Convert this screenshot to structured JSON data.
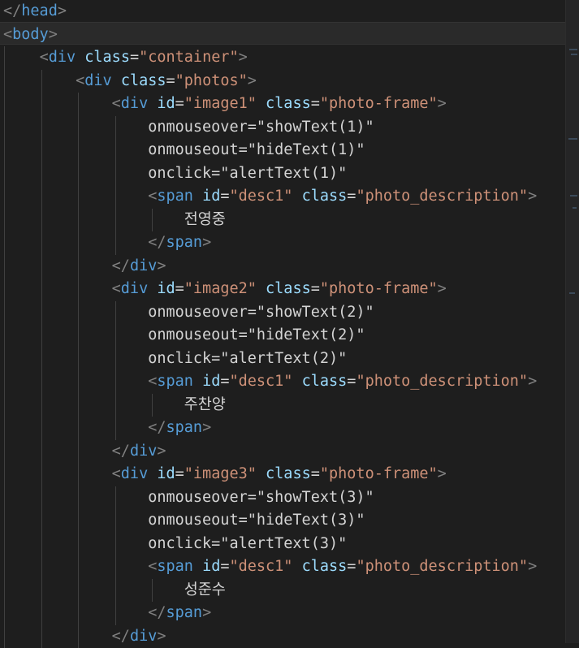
{
  "editor": {
    "lines": [
      {
        "parts": [
          [
            "t",
            "</"
          ],
          [
            "tag",
            "head"
          ],
          [
            "t",
            ">"
          ]
        ]
      },
      {
        "parts": [
          [
            "t",
            "<"
          ],
          [
            "tag",
            "body"
          ],
          [
            "t",
            ">"
          ]
        ]
      },
      {
        "parts": [
          [
            "txt",
            "    "
          ],
          [
            "t",
            "<"
          ],
          [
            "tag",
            "div"
          ],
          [
            "txt",
            " "
          ],
          [
            "attr",
            "class"
          ],
          [
            "txt",
            "="
          ],
          [
            "str",
            "\"container\""
          ],
          [
            "t",
            ">"
          ]
        ]
      },
      {
        "parts": [
          [
            "txt",
            "        "
          ],
          [
            "t",
            "<"
          ],
          [
            "tag",
            "div"
          ],
          [
            "txt",
            " "
          ],
          [
            "attr",
            "class"
          ],
          [
            "txt",
            "="
          ],
          [
            "str",
            "\"photos\""
          ],
          [
            "t",
            ">"
          ]
        ]
      },
      {
        "parts": [
          [
            "txt",
            "            "
          ],
          [
            "t",
            "<"
          ],
          [
            "tag",
            "div"
          ],
          [
            "txt",
            " "
          ],
          [
            "attr",
            "id"
          ],
          [
            "txt",
            "="
          ],
          [
            "str",
            "\"image1\""
          ],
          [
            "txt",
            " "
          ],
          [
            "attr",
            "class"
          ],
          [
            "txt",
            "="
          ],
          [
            "str",
            "\"photo-frame\""
          ],
          [
            "t",
            ">"
          ]
        ]
      },
      {
        "parts": [
          [
            "txt",
            "                onmouseover=\"showText(1)\""
          ]
        ]
      },
      {
        "parts": [
          [
            "txt",
            "                onmouseout=\"hideText(1)\""
          ]
        ]
      },
      {
        "parts": [
          [
            "txt",
            "                onclick=\"alertText(1)\""
          ]
        ]
      },
      {
        "parts": [
          [
            "txt",
            "                "
          ],
          [
            "t",
            "<"
          ],
          [
            "tag",
            "span"
          ],
          [
            "txt",
            " "
          ],
          [
            "attr",
            "id"
          ],
          [
            "txt",
            "="
          ],
          [
            "str",
            "\"desc1\""
          ],
          [
            "txt",
            " "
          ],
          [
            "attr",
            "class"
          ],
          [
            "txt",
            "="
          ],
          [
            "str",
            "\"photo_description\""
          ],
          [
            "t",
            ">"
          ]
        ]
      },
      {
        "parts": [
          [
            "txt",
            "                    전영중"
          ]
        ]
      },
      {
        "parts": [
          [
            "txt",
            "                "
          ],
          [
            "t",
            "</"
          ],
          [
            "tag",
            "span"
          ],
          [
            "t",
            ">"
          ]
        ]
      },
      {
        "parts": [
          [
            "txt",
            "            "
          ],
          [
            "t",
            "</"
          ],
          [
            "tag",
            "div"
          ],
          [
            "t",
            ">"
          ]
        ]
      },
      {
        "parts": [
          [
            "txt",
            "            "
          ],
          [
            "t",
            "<"
          ],
          [
            "tag",
            "div"
          ],
          [
            "txt",
            " "
          ],
          [
            "attr",
            "id"
          ],
          [
            "txt",
            "="
          ],
          [
            "str",
            "\"image2\""
          ],
          [
            "txt",
            " "
          ],
          [
            "attr",
            "class"
          ],
          [
            "txt",
            "="
          ],
          [
            "str",
            "\"photo-frame\""
          ],
          [
            "t",
            ">"
          ]
        ]
      },
      {
        "parts": [
          [
            "txt",
            "                onmouseover=\"showText(2)\""
          ]
        ]
      },
      {
        "parts": [
          [
            "txt",
            "                onmouseout=\"hideText(2)\""
          ]
        ]
      },
      {
        "parts": [
          [
            "txt",
            "                onclick=\"alertText(2)\""
          ]
        ]
      },
      {
        "parts": [
          [
            "txt",
            "                "
          ],
          [
            "t",
            "<"
          ],
          [
            "tag",
            "span"
          ],
          [
            "txt",
            " "
          ],
          [
            "attr",
            "id"
          ],
          [
            "txt",
            "="
          ],
          [
            "str",
            "\"desc1\""
          ],
          [
            "txt",
            " "
          ],
          [
            "attr",
            "class"
          ],
          [
            "txt",
            "="
          ],
          [
            "str",
            "\"photo_description\""
          ],
          [
            "t",
            ">"
          ]
        ]
      },
      {
        "parts": [
          [
            "txt",
            "                    주찬양"
          ]
        ]
      },
      {
        "parts": [
          [
            "txt",
            "                "
          ],
          [
            "t",
            "</"
          ],
          [
            "tag",
            "span"
          ],
          [
            "t",
            ">"
          ]
        ]
      },
      {
        "parts": [
          [
            "txt",
            "            "
          ],
          [
            "t",
            "</"
          ],
          [
            "tag",
            "div"
          ],
          [
            "t",
            ">"
          ]
        ]
      },
      {
        "parts": [
          [
            "txt",
            "            "
          ],
          [
            "t",
            "<"
          ],
          [
            "tag",
            "div"
          ],
          [
            "txt",
            " "
          ],
          [
            "attr",
            "id"
          ],
          [
            "txt",
            "="
          ],
          [
            "str",
            "\"image3\""
          ],
          [
            "txt",
            " "
          ],
          [
            "attr",
            "class"
          ],
          [
            "txt",
            "="
          ],
          [
            "str",
            "\"photo-frame\""
          ],
          [
            "t",
            ">"
          ]
        ]
      },
      {
        "parts": [
          [
            "txt",
            "                onmouseover=\"showText(3)\""
          ]
        ]
      },
      {
        "parts": [
          [
            "txt",
            "                onmouseout=\"hideText(3)\""
          ]
        ]
      },
      {
        "parts": [
          [
            "txt",
            "                onclick=\"alertText(3)\""
          ]
        ]
      },
      {
        "parts": [
          [
            "txt",
            "                "
          ],
          [
            "t",
            "<"
          ],
          [
            "tag",
            "span"
          ],
          [
            "txt",
            " "
          ],
          [
            "attr",
            "id"
          ],
          [
            "txt",
            "="
          ],
          [
            "str",
            "\"desc1\""
          ],
          [
            "txt",
            " "
          ],
          [
            "attr",
            "class"
          ],
          [
            "txt",
            "="
          ],
          [
            "str",
            "\"photo_description\""
          ],
          [
            "t",
            ">"
          ]
        ]
      },
      {
        "parts": [
          [
            "txt",
            "                    성준수"
          ]
        ]
      },
      {
        "parts": [
          [
            "txt",
            "                "
          ],
          [
            "t",
            "</"
          ],
          [
            "tag",
            "span"
          ],
          [
            "t",
            ">"
          ]
        ]
      },
      {
        "parts": [
          [
            "txt",
            "            "
          ],
          [
            "t",
            "</"
          ],
          [
            "tag",
            "div"
          ],
          [
            "t",
            ">"
          ]
        ]
      }
    ]
  },
  "colors": {
    "background": "#1e1e1e",
    "bracket": "#808080",
    "tag": "#569cd6",
    "attribute": "#9cdcfe",
    "string": "#ce9178",
    "text": "#d4d4d4"
  }
}
